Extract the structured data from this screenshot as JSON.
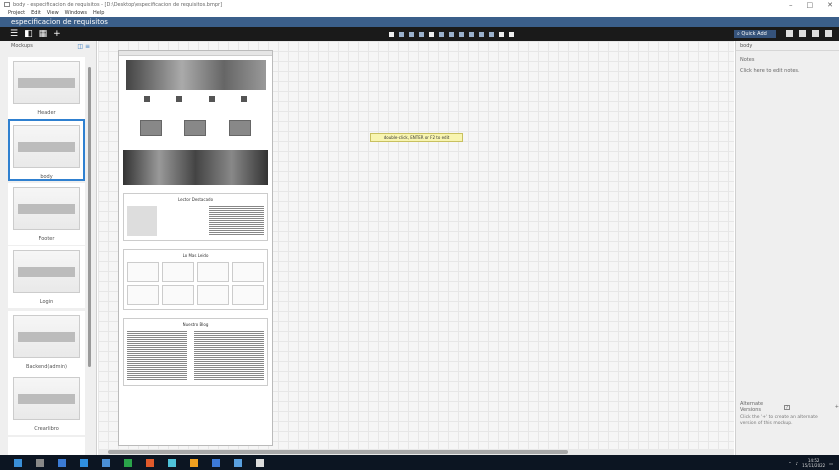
{
  "window": {
    "title": "body - especificacion de requisitos - [D:\\Desktop\\especificacion de requisitos.bmpr]",
    "controls": [
      "–",
      "□",
      "✕"
    ]
  },
  "menu": [
    "Project",
    "Edit",
    "View",
    "Windows",
    "Help"
  ],
  "project_name": "especificacion de requisitos",
  "toolbar": {
    "quick_add_placeholder": "Quick Add",
    "icons": [
      "hamburger-icon",
      "panel-toggle-icon",
      "grid-icon",
      "plus-icon"
    ]
  },
  "mockups_panel": {
    "title": "Mockups",
    "items": [
      {
        "label": "Header",
        "selected": false
      },
      {
        "label": "body",
        "selected": true
      },
      {
        "label": "Footer",
        "selected": false
      },
      {
        "label": "Login",
        "selected": false
      },
      {
        "label": "Backend(admin)",
        "selected": false
      },
      {
        "label": "Crearlibro",
        "selected": false
      }
    ]
  },
  "canvas": {
    "hint": "double-click, ENTER or F2 to edit",
    "mockup": {
      "sections": [
        "Lector Destacado",
        "Lo Mas Leido",
        "Nuestro Blog"
      ]
    }
  },
  "right_panel": {
    "title": "body",
    "notes_label": "Notes",
    "notes_hint": "Click here to edit notes.",
    "alternate_versions_label": "Alternate Versions",
    "alternate_versions_badge": "?",
    "alternate_add_icon": "+",
    "alternate_hint": "Click the '+' to create an alternate version of this mockup."
  },
  "taskbar": {
    "time": "14:52",
    "date": "15/11/2022"
  },
  "colors": {
    "project_bar": "#3b5f8a",
    "toolbar": "#1a1a1a",
    "selection": "#2f80d0",
    "taskbar": "#0c1522",
    "tooltip": "#f8f5b0"
  }
}
